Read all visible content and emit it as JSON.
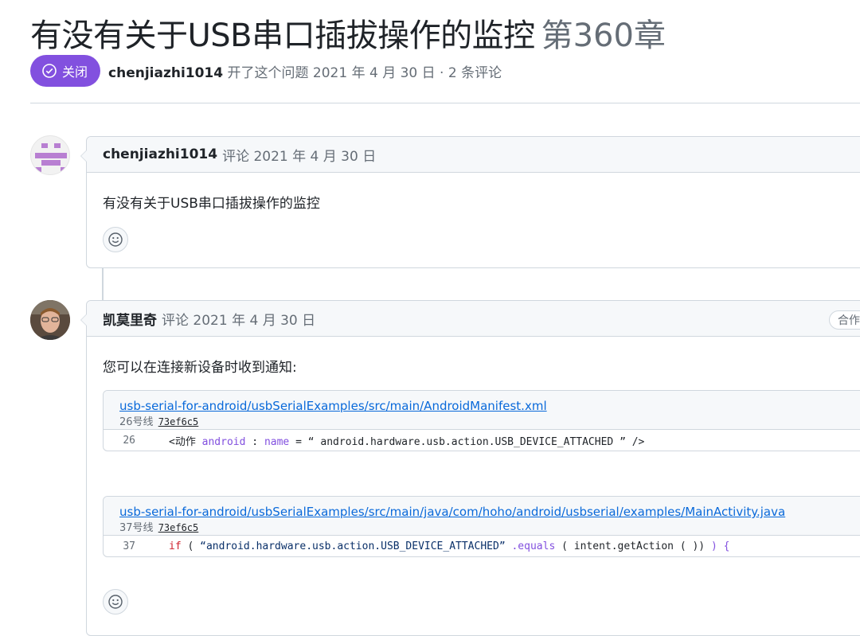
{
  "issue": {
    "title": "有没有关于USB串口插拔操作的监控",
    "number": "第360章",
    "status": "关闭",
    "author": "chenjiazhi1014",
    "opened_text": "开了这个问题 2021 年 4 月 30 日 · 2 条评论"
  },
  "comments": [
    {
      "author": "chenjiazhi1014",
      "action": "评论 2021 年 4 月 30 日",
      "body": "有没有关于USB串口插拔操作的监控"
    },
    {
      "author": "凯莫里奇",
      "action": "评论 2021 年 4 月 30 日",
      "role": "合作者",
      "body": "您可以在连接新设备时收到通知:",
      "snippets": [
        {
          "path": "usb-serial-for-android/usbSerialExamples/src/main/AndroidManifest.xml",
          "line_label": "26号线",
          "commit": "73ef6c5",
          "line_no": "26",
          "code": {
            "p1": "<动作 ",
            "p2": "android",
            "p3": " : ",
            "p4": "name",
            "p5": " = “ android.hardware.usb.action.USB_DEVICE_ATTACHED ” />"
          }
        },
        {
          "path": "usb-serial-for-android/usbSerialExamples/src/main/java/com/hoho/android/usbserial/examples/MainActivity.java",
          "line_label": "37号线",
          "commit": "73ef6c5",
          "line_no": "37",
          "code": {
            "p1": "if",
            "p2": " ( ",
            "p3": "“android.hardware.usb.action.USB_DEVICE_ATTACHED”",
            "p4": " .equals",
            "p5": " ( intent.getAction ( )) ",
            "p6": ") {"
          }
        }
      ]
    }
  ],
  "icons": [
    "check-circle-icon",
    "smiley-icon",
    "identicon",
    "user-photo"
  ],
  "colors": {
    "closed": "#8250df",
    "link": "#0969da",
    "border": "#d0d7de",
    "header_bg": "#f6f8fa"
  }
}
